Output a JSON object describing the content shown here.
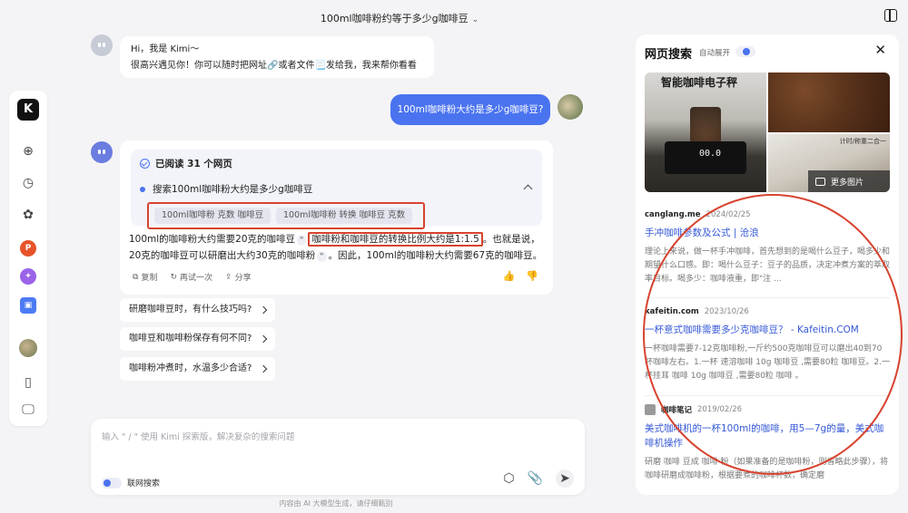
{
  "header": {
    "title": "100ml咖啡粉约等于多少g咖啡豆"
  },
  "rail": {
    "logo": "K"
  },
  "greeting": {
    "line1": "Hi，我是 Kimi～",
    "line2": "很高兴遇见你！你可以随时把网址🔗或者文件📃发给我，我来帮你看看"
  },
  "user_message": "100ml咖啡粉大约是多少g咖啡豆?",
  "answer": {
    "read_status": "已阅读 31 个网页",
    "search_query": "搜索100ml咖啡粉大约是多少g咖啡豆",
    "chips": [
      "100ml咖啡粉 克数 咖啡豆",
      "100ml咖啡粉 转换 咖啡豆 克数"
    ],
    "text_a": "100ml的咖啡粉大约需要20克的咖啡豆",
    "text_b": "咖啡粉和咖啡豆的转换比例大约是1:1.5",
    "text_c": "。也就是说，20克的咖啡豆可以研磨出大约30克的咖啡粉",
    "text_d": "。因此，100ml的咖啡粉大约需要67克的咖啡豆。",
    "actions": {
      "copy": "复制",
      "retry": "再试一次",
      "share": "分享"
    }
  },
  "suggestions": [
    "研磨咖啡豆时，有什么技巧吗?",
    "咖啡豆和咖啡粉保存有何不同?",
    "咖啡粉冲煮时，水温多少合适?"
  ],
  "input": {
    "placeholder": "输入 \" / \" 使用 Kimi 探索版，解决复杂的搜索问题",
    "web_search_label": "联网搜索"
  },
  "footer_note": "内容由 AI 大模型生成，请仔细甄别",
  "right_panel": {
    "title": "网页搜索",
    "auto_expand_label": "自动展开",
    "image_caption": "智能咖啡电子秤",
    "image_tag": "计时/称重二合一",
    "scale_digits": "00.0",
    "more_images": "更多图片",
    "sources": [
      {
        "site": "canglang.me",
        "date": "2024/02/25",
        "title": "手冲咖啡参数及公式 | 沧浪",
        "snippet": "理论上来说，做一杯手冲咖啡，首先想到的是喝什么豆子，喝多少和期望什么口感。即：喝什么豆子：豆子的品质，决定冲煮方案的萃取率目标。喝多少：咖啡液重，即\"注 ..."
      },
      {
        "site": "kafeitin.com",
        "date": "2023/10/26",
        "title": "一杯意式咖啡需要多少克咖啡豆？ - Kafeitin.COM",
        "snippet": "一杯咖啡需要7-12克咖啡粉,一斤约500克咖啡豆可以磨出40到70杯咖啡左右。1.一杯 速溶咖啡 10g 咖啡豆 ,需要80粒 咖啡豆。2.一杯挂耳 咖啡 10g 咖啡豆 ,需要80粒 咖啡 。"
      },
      {
        "site": "咖啡笔记",
        "date": "2019/02/26",
        "title": "美式咖啡机的一杯100ml的咖啡，用5—7g的量，美式咖啡机操作",
        "snippet": "研磨 咖啡 豆成 咖啡 粉（如果准备的是咖啡粉，则省略此步骤），将咖啡研磨成咖啡粉，根据要煮的咖啡杯数，确定磨"
      }
    ]
  },
  "colors": {
    "accent": "#4a73f0",
    "annotation": "#d8432f",
    "link": "#3558d6"
  }
}
